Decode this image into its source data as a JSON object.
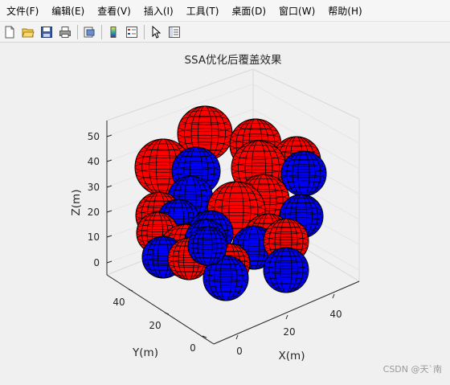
{
  "menu": {
    "items": [
      "文件(F)",
      "编辑(E)",
      "查看(V)",
      "插入(I)",
      "工具(T)",
      "桌面(D)",
      "窗口(W)",
      "帮助(H)"
    ]
  },
  "toolbar": {
    "buttons": [
      "new-figure",
      "open-file",
      "save",
      "print",
      "print-preview",
      "insert-colorbar",
      "insert-legend",
      "edit-plot",
      "property-inspector"
    ]
  },
  "plot": {
    "title": "SSA优化后覆盖效果",
    "xlabel": "X(m)",
    "ylabel": "Y(m)",
    "zlabel": "Z(m)",
    "x_ticks": [
      "0",
      "20",
      "40"
    ],
    "y_ticks": [
      "0",
      "20",
      "40"
    ],
    "z_ticks": [
      "0",
      "10",
      "20",
      "30",
      "40",
      "50"
    ]
  },
  "chart_data": {
    "type": "scatter",
    "title": "SSA优化后覆盖效果",
    "xlabel": "X(m)",
    "ylabel": "Y(m)",
    "zlabel": "Z(m)",
    "z_ticks": [
      0,
      10,
      20,
      30,
      40,
      50
    ],
    "grid": true,
    "colors": {
      "red": "#ff0000",
      "blue": "#0000ff"
    }
  },
  "watermark": "CSDN @天`南"
}
